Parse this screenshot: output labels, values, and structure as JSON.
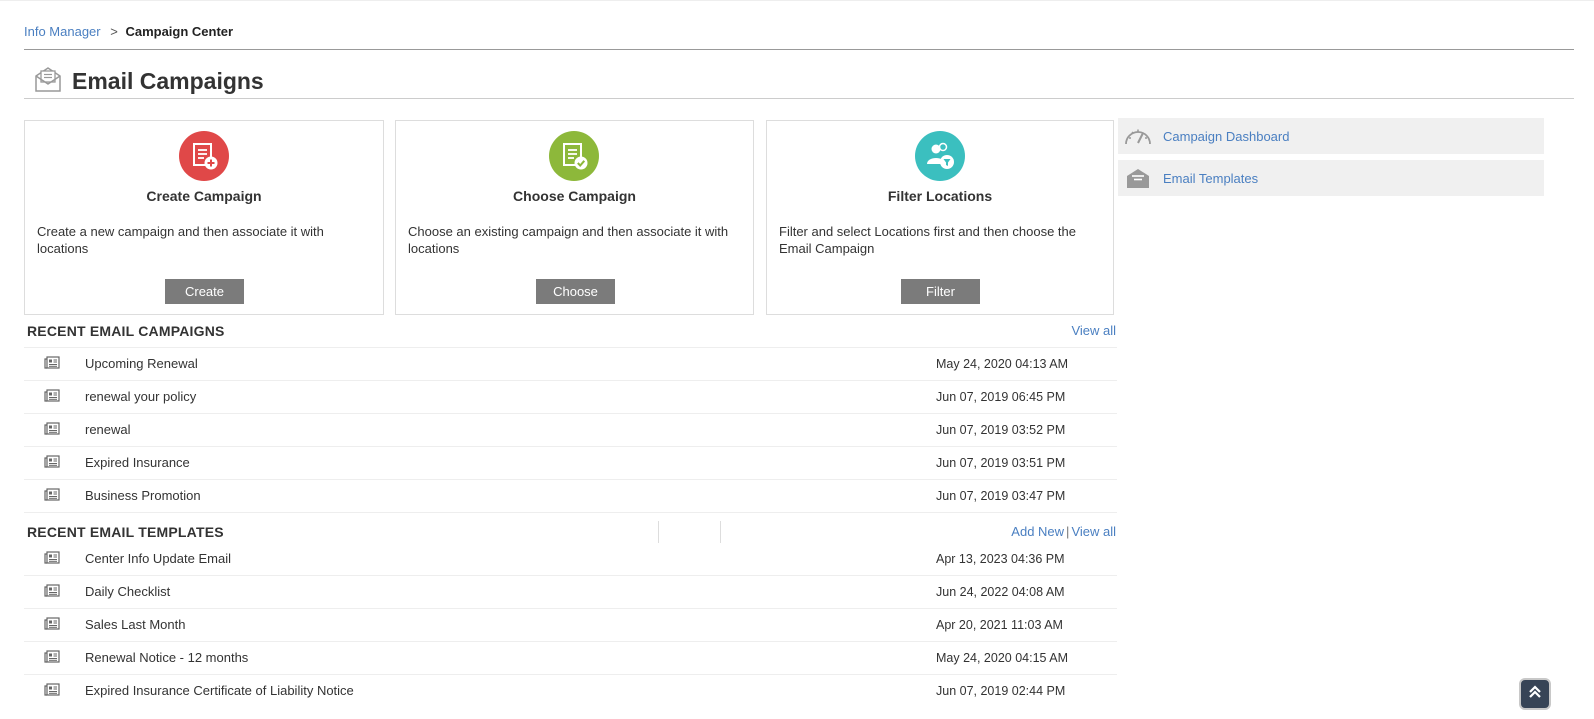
{
  "breadcrumb": {
    "parent": "Info Manager",
    "separator": ">",
    "current": "Campaign Center"
  },
  "page_title": "Email Campaigns",
  "cards": [
    {
      "icon": "create-campaign-icon",
      "color": "#e04848",
      "title": "Create Campaign",
      "description": "Create a new campaign and then associate it with locations",
      "button": "Create"
    },
    {
      "icon": "choose-campaign-icon",
      "color": "#8db83a",
      "title": "Choose Campaign",
      "description": "Choose an existing campaign and then associate it with locations",
      "button": "Choose"
    },
    {
      "icon": "filter-locations-icon",
      "color": "#3bbfbf",
      "title": "Filter Locations",
      "description": "Filter and select Locations first and then choose the Email Campaign",
      "button": "Filter"
    }
  ],
  "sidebar": [
    {
      "icon": "dashboard-gauge-icon",
      "label": "Campaign Dashboard"
    },
    {
      "icon": "email-templates-icon",
      "label": "Email Templates"
    }
  ],
  "recent_campaigns": {
    "heading": "RECENT EMAIL CAMPAIGNS",
    "view_all": "View all",
    "items": [
      {
        "name": "Upcoming Renewal",
        "date": "May 24, 2020 04:13 AM"
      },
      {
        "name": "renewal your policy",
        "date": "Jun 07, 2019 06:45 PM"
      },
      {
        "name": "renewal",
        "date": "Jun 07, 2019 03:52 PM"
      },
      {
        "name": "Expired Insurance",
        "date": "Jun 07, 2019 03:51 PM"
      },
      {
        "name": "Business Promotion",
        "date": "Jun 07, 2019 03:47 PM"
      }
    ]
  },
  "recent_templates": {
    "heading": "RECENT EMAIL TEMPLATES",
    "add_new": "Add New",
    "separator": "|",
    "view_all": "View all",
    "items": [
      {
        "name": "Center Info Update Email",
        "date": "Apr 13, 2023 04:36 PM"
      },
      {
        "name": "Daily Checklist",
        "date": "Jun 24, 2022 04:08 AM"
      },
      {
        "name": "Sales Last Month",
        "date": "Apr 20, 2021 11:03 AM"
      },
      {
        "name": "Renewal Notice - 12 months",
        "date": "May 24, 2020 04:15 AM"
      },
      {
        "name": "Expired Insurance Certificate of Liability Notice",
        "date": "Jun 07, 2019 02:44 PM"
      }
    ]
  },
  "scroll_top_icon": "double-chevron-up-icon"
}
